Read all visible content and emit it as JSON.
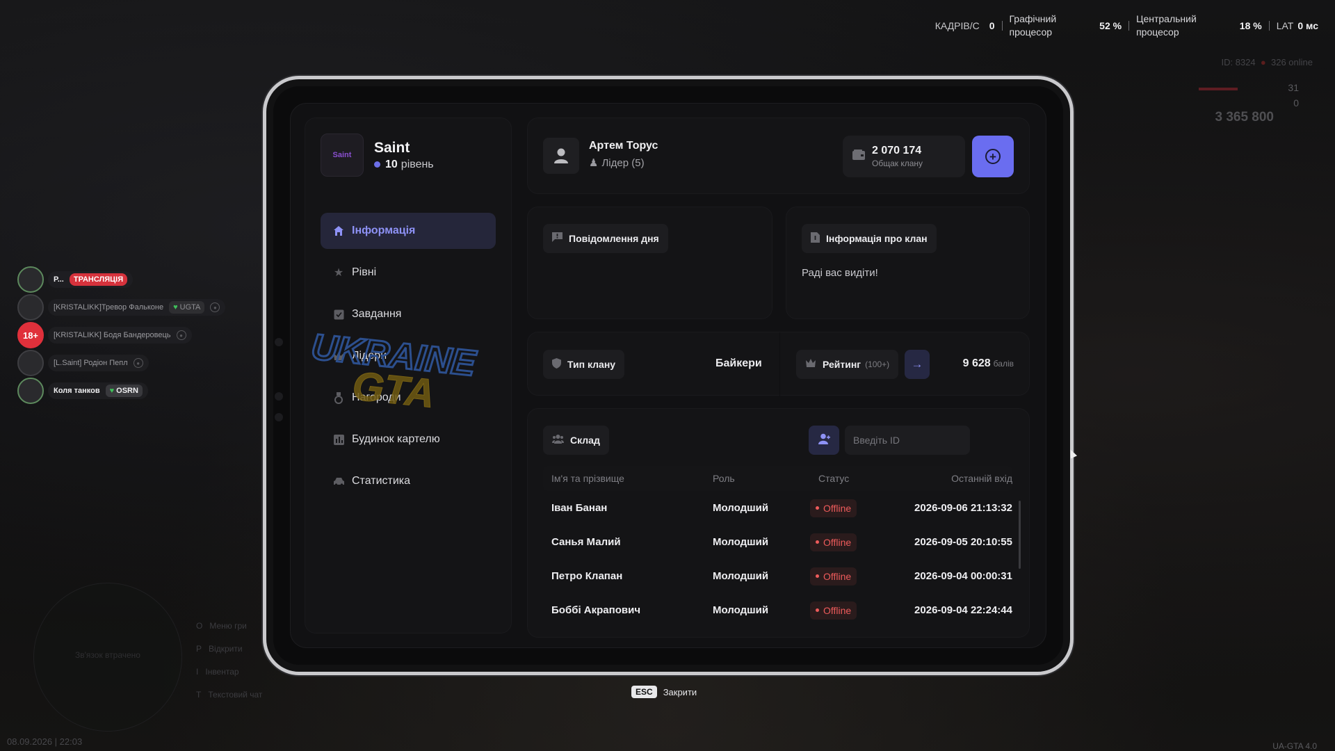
{
  "hud": {
    "fps_label": "КАДРІВ/С",
    "fps_value": "0",
    "gpu_label_1": "Графічний",
    "gpu_label_2": "процесор",
    "gpu_value": "52 %",
    "cpu_label_1": "Центральний",
    "cpu_label_2": "процесор",
    "cpu_value": "18 %",
    "lat_label": "LAT",
    "lat_value": "0 мс",
    "server_id": "ID: 8324",
    "online": "326 online",
    "health": "31",
    "armor": "0",
    "money": "3 365 800",
    "datetime": "08.09.2026 | 22:03",
    "version": "UA-GTA 4.0"
  },
  "players": [
    {
      "avatar": "",
      "name": "Р...",
      "tag": "ТРАНСЛЯЦІЯ",
      "tag_type": "live"
    },
    {
      "avatar": "",
      "name": "[KRISTALIKK]Тревор Фальконе",
      "tag": "UGTA",
      "tag_type": "faint"
    },
    {
      "avatar": "18+",
      "name": "[KRISTALIKK] Бодя Бандеровець",
      "tag": "",
      "tag_type": "none"
    },
    {
      "avatar": "",
      "name": "[L.Saint] Родіон Пепл",
      "tag": "",
      "tag_type": "none"
    },
    {
      "avatar": "",
      "name": "Коля танков",
      "tag": "OSRN",
      "tag_type": "bright"
    }
  ],
  "side_hints": [
    "Меню гри",
    "Відкрити",
    "Інвентар",
    "Текстовий чат"
  ],
  "side_hint_keys": [
    "O",
    "P",
    "I",
    "T"
  ],
  "minimap_text": "Зв'язок втрачено",
  "org": {
    "logo_text": "Saint",
    "name": "Saint",
    "level_number": "10",
    "level_word": "рівень"
  },
  "nav": [
    {
      "label": "Інформація",
      "icon": "home-icon",
      "active": true
    },
    {
      "label": "Рівні",
      "icon": "star-icon",
      "active": false
    },
    {
      "label": "Завдання",
      "icon": "checkbox-icon",
      "active": false
    },
    {
      "label": "Лідери",
      "icon": "crown-icon",
      "active": false
    },
    {
      "label": "Нагороди",
      "icon": "medal-icon",
      "active": false
    },
    {
      "label": "Будинок картелю",
      "icon": "building-icon",
      "active": false
    },
    {
      "label": "Статистика",
      "icon": "car-icon",
      "active": false
    }
  ],
  "leader": {
    "name": "Артем Торус",
    "role": "Лідер (5)"
  },
  "bank": {
    "amount": "2 070 174",
    "label": "Общак клану"
  },
  "motd": {
    "title": "Повідомлення дня",
    "text": ""
  },
  "clan_info": {
    "title": "Інформація про клан",
    "text": "Раді вас видіти!"
  },
  "clan_type": {
    "label": "Тип клану",
    "value": "Байкери"
  },
  "rating": {
    "label": "Рейтинг",
    "sub": "(100+)",
    "points": "9 628",
    "points_unit": "балів"
  },
  "roster": {
    "title": "Склад",
    "search_placeholder": "Введіть ID",
    "columns": [
      "Ім'я та прізвище",
      "Роль",
      "Статус",
      "Останній вхід"
    ],
    "rows": [
      {
        "name": "Іван Банан",
        "role": "Молодший",
        "status": "Offline",
        "last": "2026-09-06 21:13:32"
      },
      {
        "name": "Санья Малий",
        "role": "Молодший",
        "status": "Offline",
        "last": "2026-09-05 20:10:55"
      },
      {
        "name": "Петро Клапан",
        "role": "Молодший",
        "status": "Offline",
        "last": "2026-09-04 00:00:31"
      },
      {
        "name": "Боббі Акрапович",
        "role": "Молодший",
        "status": "Offline",
        "last": "2026-09-04 22:24:44"
      }
    ]
  },
  "watermark": {
    "line1": "UKRAINE",
    "line2": "GTA"
  },
  "close": {
    "key": "ESC",
    "label": "Закрити"
  },
  "colors": {
    "accent": "#6a6df0",
    "offline": "#ee5b5b",
    "live": "#d6323c"
  }
}
